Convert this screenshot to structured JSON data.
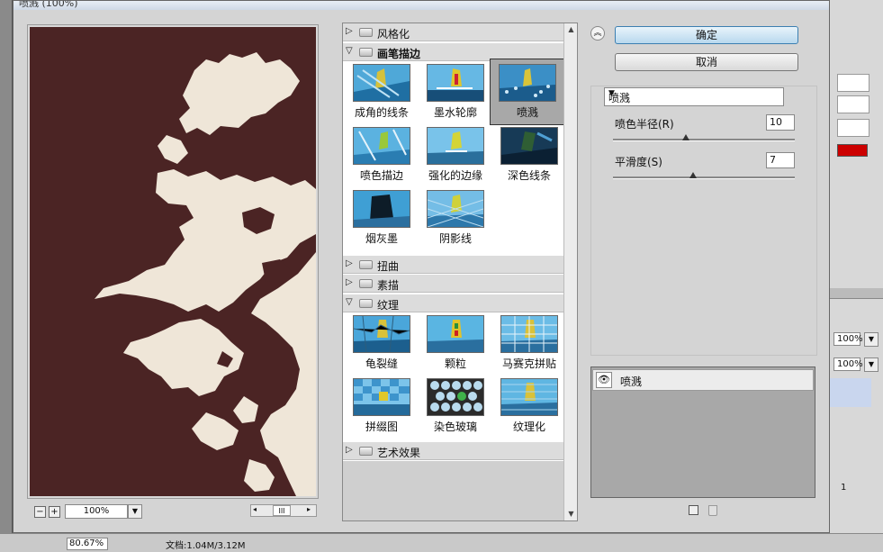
{
  "window": {
    "title": "喷溅 (100%)"
  },
  "buttons": {
    "ok": "确定",
    "cancel": "取消",
    "collapse_glyph": "︽"
  },
  "preview": {
    "zoom": "100%",
    "zoom_out_glyph": "−",
    "zoom_in_glyph": "+",
    "dropdown_glyph": "▼",
    "scroll_left_glyph": "◂",
    "scroll_right_glyph": "▸",
    "scroll_grip": "III"
  },
  "filter_gallery": {
    "expanded_glyph": "▽",
    "collapsed_glyph": "▷",
    "categories": [
      {
        "name": "风格化",
        "open": false
      },
      {
        "name": "画笔描边",
        "open": true,
        "filters": [
          "成角的线条",
          "墨水轮廓",
          "喷溅",
          "喷色描边",
          "强化的边缘",
          "深色线条",
          "烟灰墨",
          "阴影线"
        ],
        "selected": "喷溅"
      },
      {
        "name": "扭曲",
        "open": false
      },
      {
        "name": "素描",
        "open": false
      },
      {
        "name": "纹理",
        "open": true,
        "filters": [
          "龟裂缝",
          "颗粒",
          "马赛克拼贴",
          "拼缀图",
          "染色玻璃",
          "纹理化"
        ]
      },
      {
        "name": "艺术效果",
        "open": false
      }
    ],
    "scroll_up_glyph": "▲",
    "scroll_down_glyph": "▼"
  },
  "settings": {
    "filter_select": "喷溅",
    "dropdown_glyph": "▼",
    "params": [
      {
        "label": "喷色半径(R)",
        "value": "10",
        "level": 0.4
      },
      {
        "label": "平滑度(S)",
        "value": "7",
        "level": 0.44
      }
    ]
  },
  "layers": {
    "items": [
      {
        "name": "喷溅"
      }
    ],
    "eye_glyph": "👁"
  },
  "background_app": {
    "zoom_a": "100%",
    "zoom_b": "100%",
    "status_zoom": "80.67%",
    "status_doc": "文档:1.04M/3.12M",
    "dropdown_glyph": "▼",
    "layer_num": "1"
  },
  "colors": {
    "preview_background": "#4b2424",
    "preview_shapes": "#efe6d8",
    "selection": "#a8a8a8",
    "ok_button": "#b8d8ee"
  },
  "icons": [
    "eye-icon",
    "new-layer-icon",
    "delete-layer-icon",
    "folder-icon"
  ]
}
